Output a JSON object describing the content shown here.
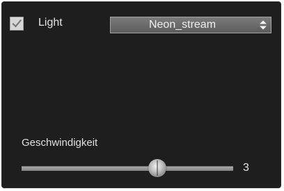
{
  "light": {
    "label": "Light",
    "checked": true
  },
  "effect_select": {
    "value": "Neon_stream"
  },
  "speed": {
    "label": "Geschwindigkeit",
    "value": "3",
    "level": 0.64
  }
}
